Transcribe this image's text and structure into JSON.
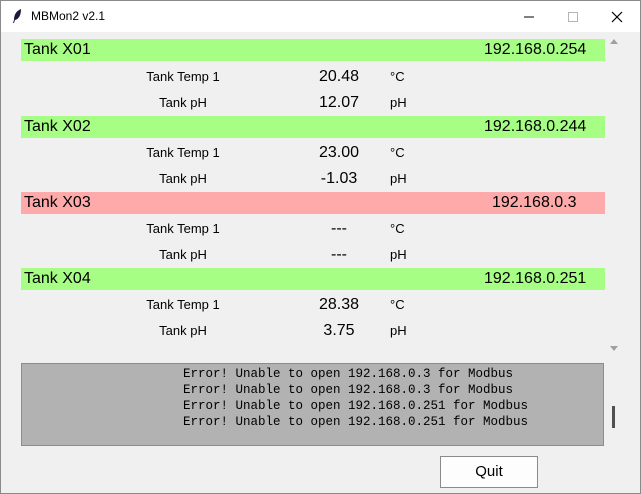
{
  "window": {
    "title": "MBMon2 v2.1"
  },
  "tanks": [
    {
      "name": "Tank X01",
      "ip": "192.168.0.254",
      "status": "ok",
      "readings": [
        {
          "label": "Tank Temp 1",
          "value": "20.48",
          "unit": "°C"
        },
        {
          "label": "Tank pH",
          "value": "12.07",
          "unit": "pH"
        }
      ]
    },
    {
      "name": "Tank X02",
      "ip": "192.168.0.244",
      "status": "ok",
      "readings": [
        {
          "label": "Tank Temp 1",
          "value": "23.00",
          "unit": "°C"
        },
        {
          "label": "Tank pH",
          "value": "-1.03",
          "unit": "pH"
        }
      ]
    },
    {
      "name": "Tank X03",
      "ip": "192.168.0.3",
      "status": "error",
      "readings": [
        {
          "label": "Tank Temp 1",
          "value": "---",
          "unit": "°C"
        },
        {
          "label": "Tank pH",
          "value": "---",
          "unit": "pH"
        }
      ]
    },
    {
      "name": "Tank X04",
      "ip": "192.168.0.251",
      "status": "ok",
      "readings": [
        {
          "label": "Tank Temp 1",
          "value": "28.38",
          "unit": "°C"
        },
        {
          "label": "Tank pH",
          "value": "3.75",
          "unit": "pH"
        }
      ]
    }
  ],
  "log": [
    "Error! Unable to open 192.168.0.3 for Modbus",
    "Error! Unable to open 192.168.0.3 for Modbus",
    "Error! Unable to open 192.168.0.251 for Modbus",
    "Error! Unable to open 192.168.0.251 for Modbus"
  ],
  "buttons": {
    "quit": "Quit"
  },
  "colors": {
    "ok": "#a6ff84",
    "error": "#ffaaaa",
    "log_bg": "#b2b2b2"
  }
}
